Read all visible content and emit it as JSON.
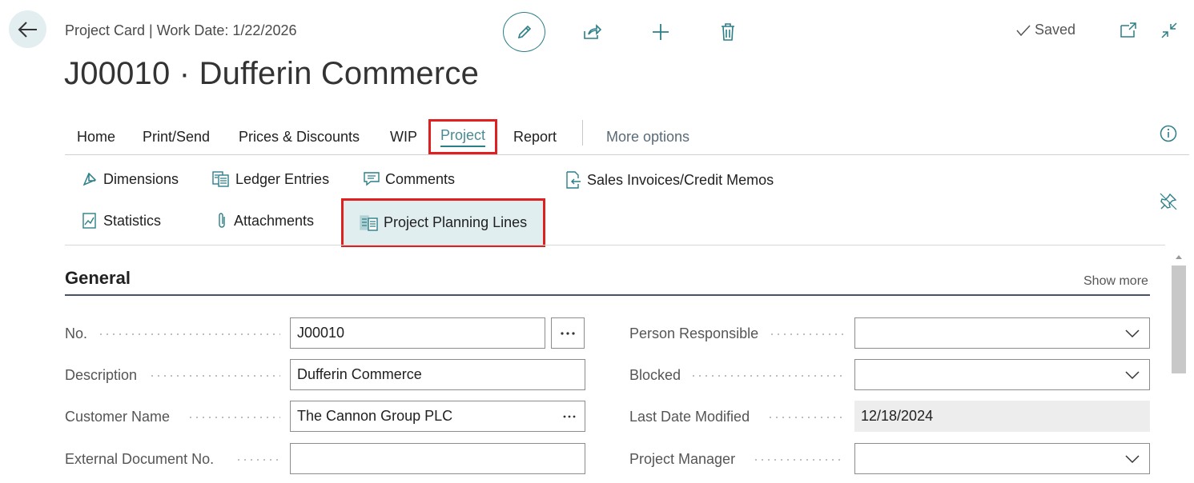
{
  "header": {
    "caption": "Project Card | Work Date: 1/22/2026",
    "title": "J00010 · Dufferin Commerce",
    "saved_label": "Saved"
  },
  "action_tabs": [
    {
      "label": "Home"
    },
    {
      "label": "Print/Send"
    },
    {
      "label": "Prices & Discounts"
    },
    {
      "label": "WIP"
    },
    {
      "label": "Project"
    },
    {
      "label": "Report"
    }
  ],
  "more_options": "More options",
  "sub_actions": {
    "dimensions": "Dimensions",
    "ledger_entries": "Ledger Entries",
    "comments": "Comments",
    "sales_invoices": "Sales Invoices/Credit Memos",
    "statistics": "Statistics",
    "attachments": "Attachments",
    "planning_lines": "Project Planning Lines"
  },
  "general": {
    "title": "General",
    "show_more": "Show more",
    "left_fields": [
      {
        "label": "No.",
        "value": "J00010"
      },
      {
        "label": "Description",
        "value": "Dufferin Commerce"
      },
      {
        "label": "Customer Name",
        "value": "The Cannon Group PLC"
      },
      {
        "label": "External Document No.",
        "value": ""
      }
    ],
    "right_fields": [
      {
        "label": "Person Responsible",
        "value": ""
      },
      {
        "label": "Blocked",
        "value": ""
      },
      {
        "label": "Last Date Modified",
        "value": "12/18/2024"
      },
      {
        "label": "Project Manager",
        "value": ""
      }
    ]
  },
  "colors": {
    "accent": "#2a7f88",
    "highlight_border": "#e02020",
    "highlight_bg": "#e1eef0"
  }
}
